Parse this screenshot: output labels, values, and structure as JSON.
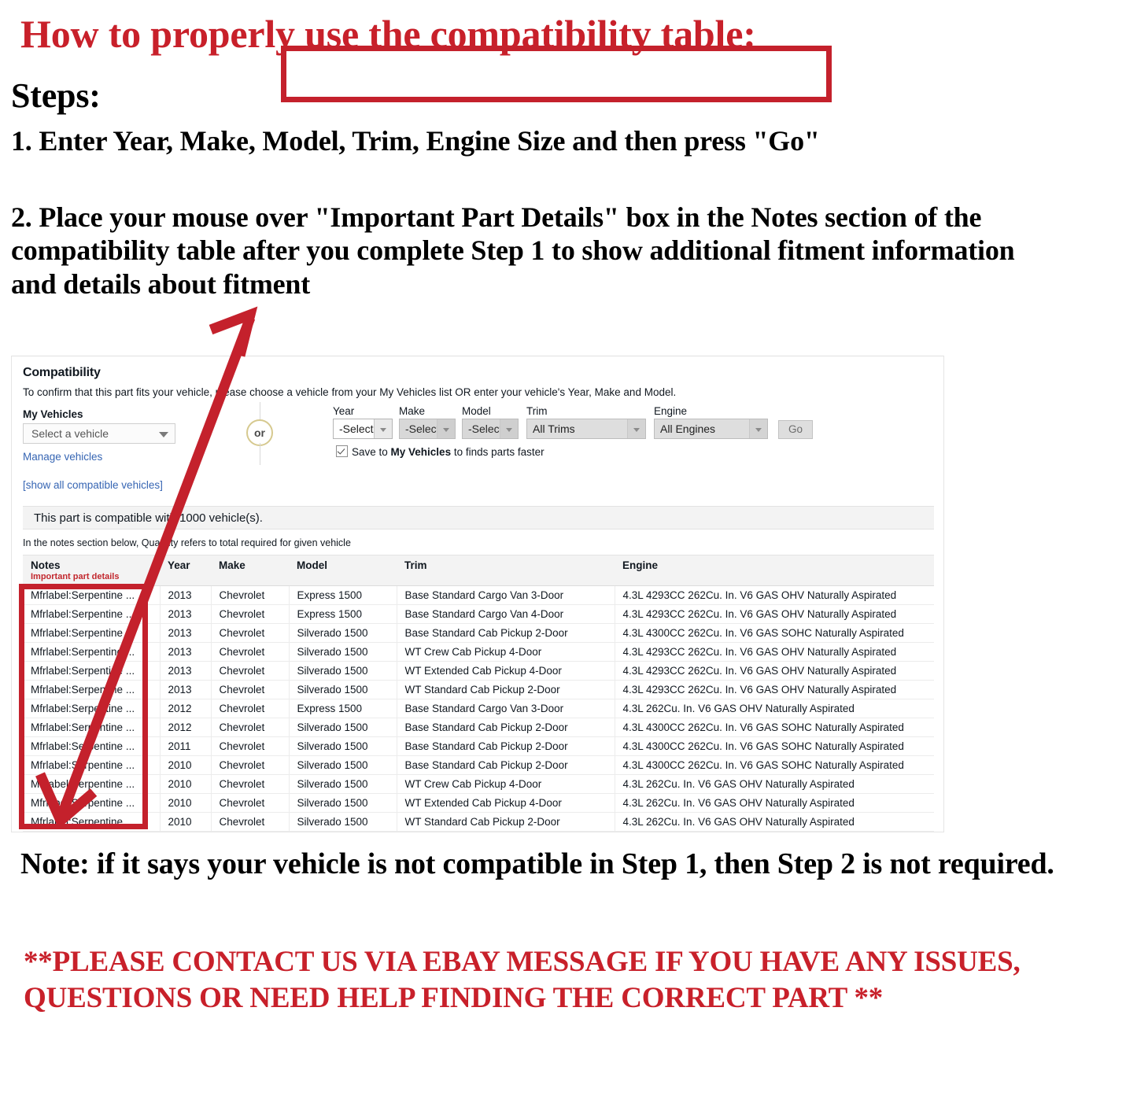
{
  "headline": "How to properly use the compatibility table:",
  "steps_label": "Steps:",
  "step1": "1. Enter Year, Make, Model, Trim, Engine Size and then press \"Go\"",
  "step2": "2. Place your mouse over \"Important Part Details\" box in the Notes section of the compatibility table after you complete Step 1 to show additional fitment information and details about fitment",
  "note": "Note: if it says your vehicle is not compatible in Step 1, then Step 2 is not required.",
  "contact": "**PLEASE CONTACT US VIA EBAY MESSAGE IF YOU HAVE ANY ISSUES, QUESTIONS OR NEED HELP FINDING THE CORRECT PART **",
  "colors": {
    "red_text": "#c8202a",
    "highlight_red": "#c4212c",
    "link_blue": "#3665b3",
    "or_ring": "#d6c98f",
    "header_bg": "#f3f3f3"
  },
  "widget": {
    "title": "Compatibility",
    "subtitle": "To confirm that this part fits your vehicle, please choose a vehicle from your My Vehicles list OR enter your vehicle's Year, Make and Model.",
    "my_vehicles_label": "My Vehicles",
    "my_vehicles_value": "Select a vehicle",
    "manage_vehicles_link": "Manage vehicles",
    "show_all_link": "[show all compatible vehicles]",
    "or_text": "or",
    "fields": [
      {
        "label": "Year",
        "value": "-Select-",
        "state": "enabled"
      },
      {
        "label": "Make",
        "value": "-Select-",
        "state": "disabled"
      },
      {
        "label": "Model",
        "value": "-Select-",
        "state": "disabled"
      },
      {
        "label": "Trim",
        "value": "All Trims",
        "state": "soft"
      },
      {
        "label": "Engine",
        "value": "All Engines",
        "state": "soft"
      }
    ],
    "go_label": "Go",
    "save_prefix": "Save to ",
    "save_bold": "My Vehicles",
    "save_suffix": " to finds parts faster",
    "compatible_count_text": "This part is compatible with 1000 vehicle(s).",
    "quantity_note": "In the notes section below, Quantity refers to total required for given vehicle",
    "table": {
      "headers": [
        "Notes",
        "Year",
        "Make",
        "Model",
        "Trim",
        "Engine"
      ],
      "notes_subheader": "Important part details",
      "rows": [
        {
          "notes": "Mfrlabel:Serpentine ...",
          "year": "2013",
          "make": "Chevrolet",
          "model": "Express 1500",
          "trim": "Base Standard Cargo Van 3-Door",
          "engine": "4.3L 4293CC 262Cu. In. V6 GAS OHV Naturally Aspirated"
        },
        {
          "notes": "Mfrlabel:Serpentine ...",
          "year": "2013",
          "make": "Chevrolet",
          "model": "Express 1500",
          "trim": "Base Standard Cargo Van 4-Door",
          "engine": "4.3L 4293CC 262Cu. In. V6 GAS OHV Naturally Aspirated"
        },
        {
          "notes": "Mfrlabel:Serpentine ...",
          "year": "2013",
          "make": "Chevrolet",
          "model": "Silverado 1500",
          "trim": "Base Standard Cab Pickup 2-Door",
          "engine": "4.3L 4300CC 262Cu. In. V6 GAS SOHC Naturally Aspirated"
        },
        {
          "notes": "Mfrlabel:Serpentine ...",
          "year": "2013",
          "make": "Chevrolet",
          "model": "Silverado 1500",
          "trim": "WT Crew Cab Pickup 4-Door",
          "engine": "4.3L 4293CC 262Cu. In. V6 GAS OHV Naturally Aspirated"
        },
        {
          "notes": "Mfrlabel:Serpentine ...",
          "year": "2013",
          "make": "Chevrolet",
          "model": "Silverado 1500",
          "trim": "WT Extended Cab Pickup 4-Door",
          "engine": "4.3L 4293CC 262Cu. In. V6 GAS OHV Naturally Aspirated"
        },
        {
          "notes": "Mfrlabel:Serpentine ...",
          "year": "2013",
          "make": "Chevrolet",
          "model": "Silverado 1500",
          "trim": "WT Standard Cab Pickup 2-Door",
          "engine": "4.3L 4293CC 262Cu. In. V6 GAS OHV Naturally Aspirated"
        },
        {
          "notes": "Mfrlabel:Serpentine ...",
          "year": "2012",
          "make": "Chevrolet",
          "model": "Express 1500",
          "trim": "Base Standard Cargo Van 3-Door",
          "engine": "4.3L 262Cu. In. V6 GAS OHV Naturally Aspirated"
        },
        {
          "notes": "Mfrlabel:Serpentine ...",
          "year": "2012",
          "make": "Chevrolet",
          "model": "Silverado 1500",
          "trim": "Base Standard Cab Pickup 2-Door",
          "engine": "4.3L 4300CC 262Cu. In. V6 GAS SOHC Naturally Aspirated"
        },
        {
          "notes": "Mfrlabel:Serpentine ...",
          "year": "2011",
          "make": "Chevrolet",
          "model": "Silverado 1500",
          "trim": "Base Standard Cab Pickup 2-Door",
          "engine": "4.3L 4300CC 262Cu. In. V6 GAS SOHC Naturally Aspirated"
        },
        {
          "notes": "Mfrlabel:Serpentine ...",
          "year": "2010",
          "make": "Chevrolet",
          "model": "Silverado 1500",
          "trim": "Base Standard Cab Pickup 2-Door",
          "engine": "4.3L 4300CC 262Cu. In. V6 GAS SOHC Naturally Aspirated"
        },
        {
          "notes": "Mfrlabel:Serpentine ...",
          "year": "2010",
          "make": "Chevrolet",
          "model": "Silverado 1500",
          "trim": "WT Crew Cab Pickup 4-Door",
          "engine": "4.3L 262Cu. In. V6 GAS OHV Naturally Aspirated"
        },
        {
          "notes": "Mfrlabel:Serpentine ...",
          "year": "2010",
          "make": "Chevrolet",
          "model": "Silverado 1500",
          "trim": "WT Extended Cab Pickup 4-Door",
          "engine": "4.3L 262Cu. In. V6 GAS OHV Naturally Aspirated"
        },
        {
          "notes": "Mfrlabel:Serpentine ...",
          "year": "2010",
          "make": "Chevrolet",
          "model": "Silverado 1500",
          "trim": "WT Standard Cab Pickup 2-Door",
          "engine": "4.3L 262Cu. In. V6 GAS OHV Naturally Aspirated"
        }
      ]
    }
  }
}
